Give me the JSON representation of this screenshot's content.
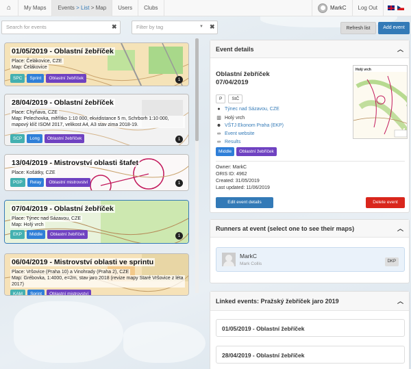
{
  "nav": {
    "home_icon": "home-icon",
    "my_maps": "My Maps",
    "events": "Events",
    "events_sub": "> List",
    "events_map": "> Map",
    "users": "Users",
    "clubs": "Clubs",
    "username": "MarkC",
    "logout": "Log Out"
  },
  "filters": {
    "search_placeholder": "Search for events",
    "tag_placeholder": "Filter by tag",
    "clear": "✖",
    "refresh": "Refresh list",
    "add_event": "Add event"
  },
  "events": [
    {
      "title": "01/05/2019 - Oblastní žebříček",
      "lines": [
        "Place: Čelákovice, CZE",
        "Map: Čelákovice"
      ],
      "tags": [
        {
          "label": "SPC",
          "color": "teal"
        },
        {
          "label": "Sprint",
          "color": "blue"
        },
        {
          "label": "Oblastní žebříček",
          "color": "purple"
        }
      ],
      "count": "1"
    },
    {
      "title": "28/04/2019 - Oblastní žebříček",
      "lines": [
        "Place: Chyňava, CZE",
        "Map: Pelechovka, měřítko 1:10 000, ekvidistance 5 m, Schrborh 1:10 000, mapový klíč ISOM 2017, velikost A4, A3 stav zima 2018-19."
      ],
      "tags": [
        {
          "label": "SCP",
          "color": "teal"
        },
        {
          "label": "Long",
          "color": "blue"
        },
        {
          "label": "Oblastní žebříček",
          "color": "purple"
        }
      ],
      "count": "1"
    },
    {
      "title": "13/04/2019 - Mistrovství oblasti štafet",
      "lines": [
        "Place: Košátky, CZE"
      ],
      "tags": [
        {
          "label": "PGP",
          "color": "teal"
        },
        {
          "label": "Relay",
          "color": "blue"
        },
        {
          "label": "Oblastní mistrovství",
          "color": "purple"
        }
      ],
      "count": "1"
    },
    {
      "title": "07/04/2019 - Oblastní žebříček",
      "lines": [
        "Place: Týnec nad Sázavou, CZE",
        "Map: Holý vrch"
      ],
      "tags": [
        {
          "label": "EKP",
          "color": "teal"
        },
        {
          "label": "Middle",
          "color": "blue"
        },
        {
          "label": "Oblastní žebříček",
          "color": "purple"
        }
      ],
      "count": "1"
    },
    {
      "title": "06/04/2019 - Mistrovství oblasti ve sprintu",
      "lines": [
        "Place: Vršovice (Praha 10) a Vinohrady (Praha 2), CZE",
        "Map: Grébovka, 1:4000, e=2m, stav jaro 2018 (revize mapy Staré Vršovice z léta 2017)"
      ],
      "tags": [
        {
          "label": "KAM",
          "color": "teal"
        },
        {
          "label": "Sprint",
          "color": "blue"
        },
        {
          "label": "Oblastní mistrovství",
          "color": "purple"
        }
      ],
      "count": ""
    }
  ],
  "details": {
    "heading": "Event details",
    "title_line1": "Oblastní žebříček",
    "title_line2": "07/04/2019",
    "pills": [
      "P",
      "StČ"
    ],
    "place": "Týnec nad Sázavou, CZE",
    "map": "Holý vrch",
    "club": "VŠTJ Ekonom Praha (EKP)",
    "website": "Event website",
    "results": "Results",
    "tags": [
      "Middle",
      "Oblastní žebříček"
    ],
    "owner": "Owner: MarkC",
    "oris": "ORIS ID: 4962",
    "created": "Created: 31/05/2019",
    "updated": "Last updated: 11/06/2019",
    "edit": "Edit event details",
    "delete": "Delete event",
    "thumb_title": "Holý vrch"
  },
  "runners": {
    "heading": "Runners at event (select one to see their maps)",
    "name": "MarkC",
    "full": "Mark Collis",
    "club": "DKP"
  },
  "linked": {
    "heading": "Linked events: Pražský žebříček jaro 2019",
    "items": [
      "01/05/2019 - Oblastní žebříček",
      "28/04/2019 - Oblastní žebříček"
    ]
  }
}
